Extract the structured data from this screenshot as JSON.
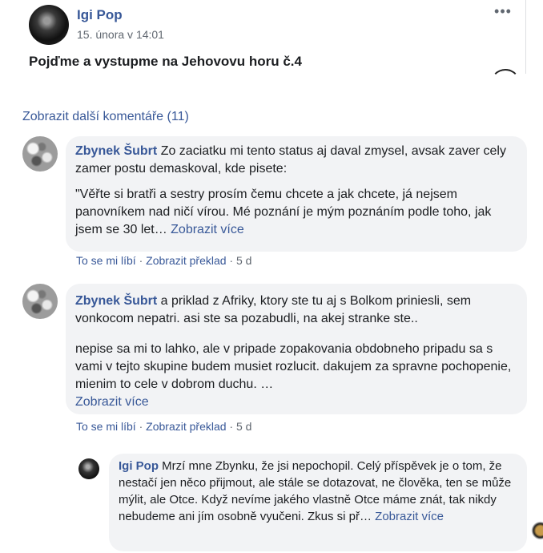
{
  "post": {
    "author": "Igi Pop",
    "time": "15. února v 14:01",
    "more_label": "•••",
    "text": "Pojďme a vystupme na Jehovovu horu č.4"
  },
  "more_comments": "Zobrazit další komentáře (11)",
  "comments": [
    {
      "author": "Zbynek Šubrt",
      "text_p1": "Zo zaciatku mi tento status aj daval zmysel, avsak zaver cely zamer postu demaskoval, kde pisete:",
      "text_p2": "\"Věřte si bratři a sestry prosím čemu chcete a jak chcete, já nejsem panovníkem nad ničí vírou. Mé poznání je mým poznáním podle toho, jak jsem se 30 let… ",
      "see_more": "Zobrazit více",
      "like": "To se mi líbí",
      "sep1": " · ",
      "translate": "Zobrazit překlad",
      "sep2": " · ",
      "age": "5 d"
    },
    {
      "author": "Zbynek Šubrt",
      "text_p1": " a priklad z Afriky, ktory ste tu aj s Bolkom priniesli, sem vonkocom nepatri. asi ste sa pozabudli, na akej stranke ste..",
      "text_p2": "nepise sa mi to lahko, ale v pripade zopakovania obdobneho pripadu sa s vami v tejto skupine budem musiet rozlucit. dakujem za spravne pochopenie, mienim to cele v dobrom duchu. …",
      "see_more": "Zobrazit více",
      "like": "To se mi líbí",
      "sep1": " · ",
      "translate": "Zobrazit překlad",
      "sep2": " · ",
      "age": "5 d"
    }
  ],
  "reply": {
    "author": "Igi Pop",
    "text": " Mrzí mne Zbynku, že jsi nepochopil. Celý příspěvek je o tom, že nestačí jen něco přijmout, ale stále se dotazovat, ne člověka, ten se může mýlit, ale Otce. Když nevíme jakého vlastně Otce máme znát, tak nikdy nebudeme ani jím osobně vyučeni. Zkus si př… ",
    "see_more": "Zobrazit více"
  }
}
